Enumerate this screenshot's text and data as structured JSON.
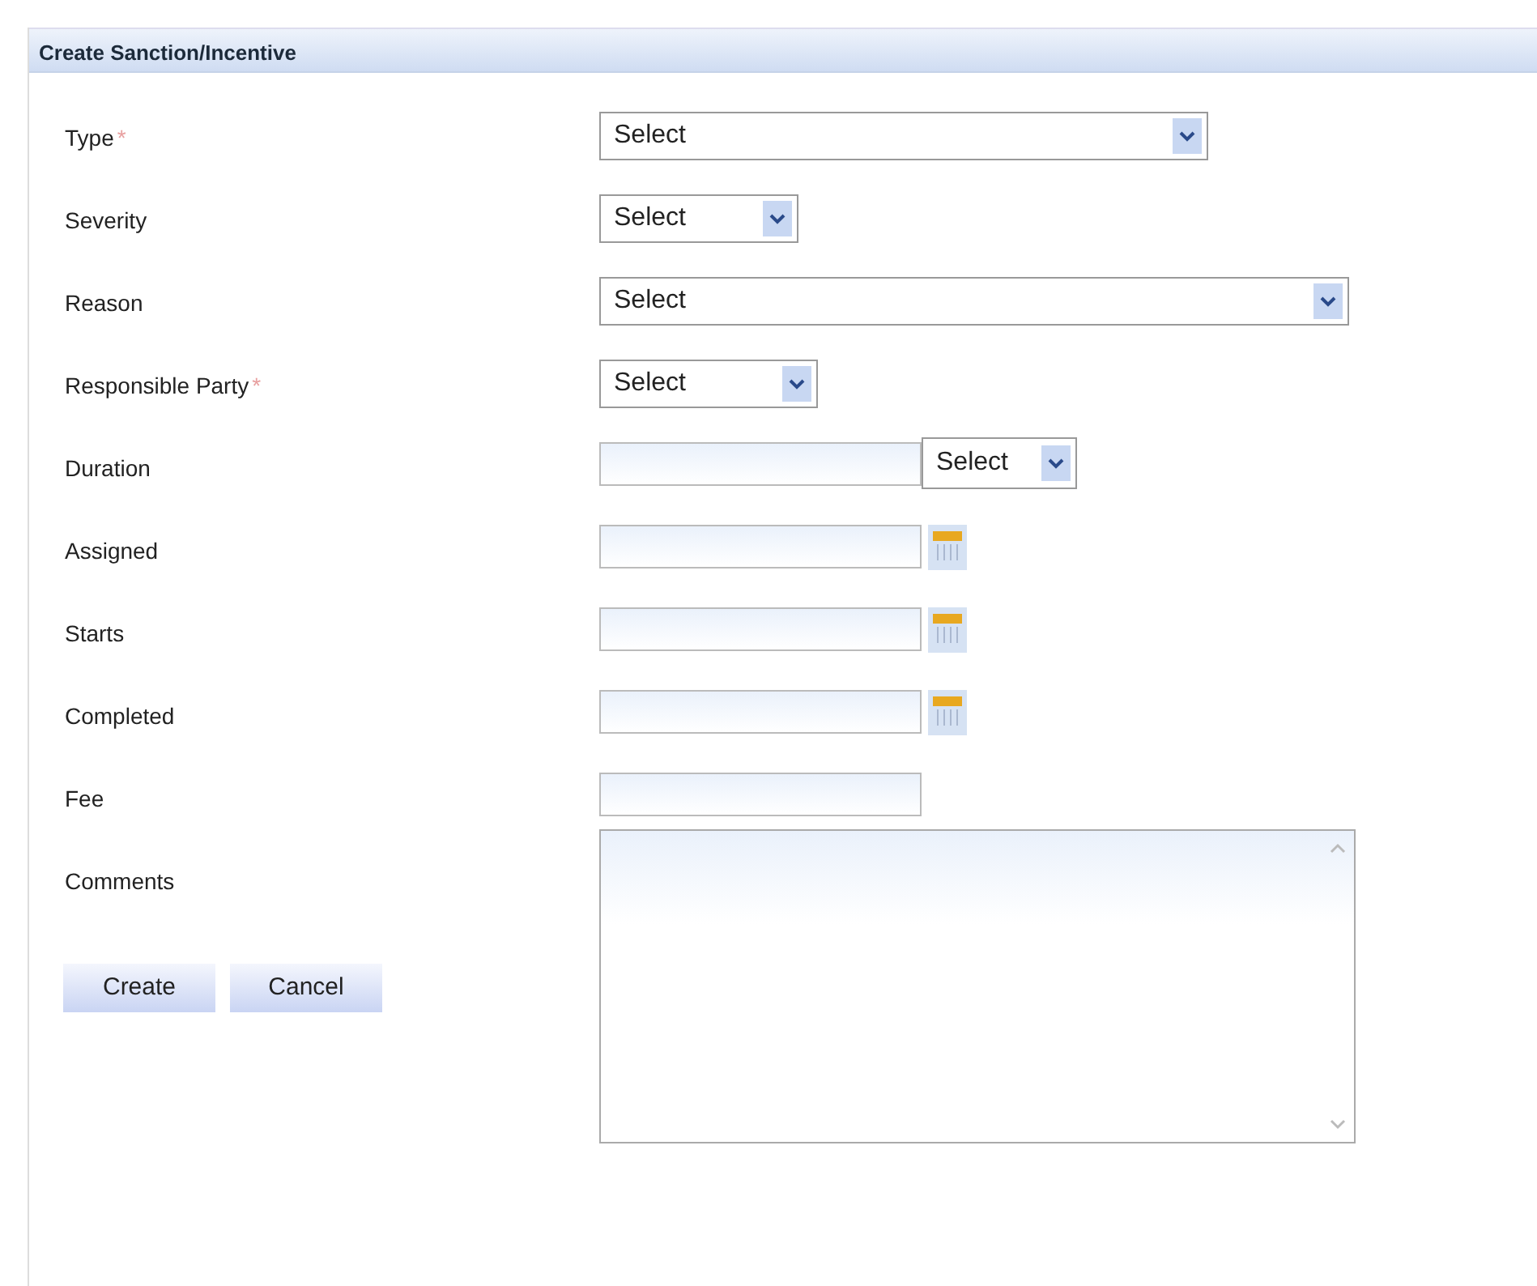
{
  "panel": {
    "title": "Create Sanction/Incentive"
  },
  "fields": [
    {
      "label": "Type",
      "required_mark": "*",
      "kind": "select",
      "value": "Select"
    },
    {
      "label": "Severity",
      "kind": "select",
      "value": "Select"
    },
    {
      "label": "Reason",
      "kind": "select",
      "value": "Select"
    },
    {
      "label": "Responsible Party",
      "required_mark": "*",
      "kind": "select",
      "value": "Select"
    },
    {
      "label": "Duration",
      "kind": "text-select",
      "value": "Select"
    },
    {
      "label": "Assigned",
      "kind": "date"
    },
    {
      "label": "Starts",
      "kind": "date"
    },
    {
      "label": "Completed",
      "kind": "date"
    },
    {
      "label": "Fee",
      "kind": "text"
    },
    {
      "label": "Comments",
      "kind": "textarea"
    }
  ],
  "buttons": [
    "Create",
    "Cancel"
  ]
}
